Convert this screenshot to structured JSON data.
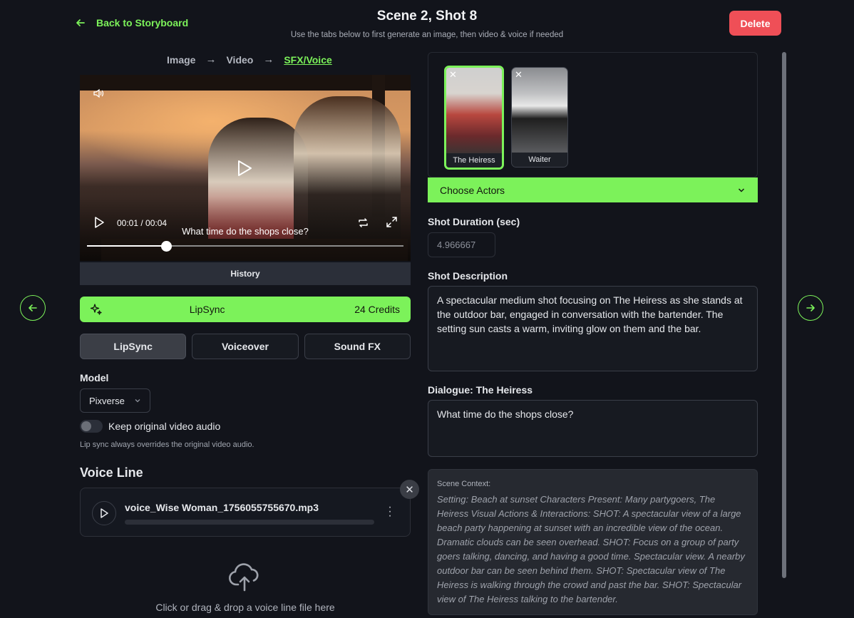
{
  "header": {
    "back_label": "Back to Storyboard",
    "title": "Scene 2, Shot 8",
    "subtitle": "Use the tabs below to first generate an image, then video & voice if needed",
    "delete_label": "Delete"
  },
  "steps": [
    "Image",
    "Video",
    "SFX/Voice"
  ],
  "video": {
    "time": "00:01 / 00:04",
    "caption": "What time do the shops close?",
    "progress_fraction": 0.25
  },
  "history_label": "History",
  "lipsync_bar": {
    "label": "LipSync",
    "credits": "24 Credits"
  },
  "tabs": [
    "LipSync",
    "Voiceover",
    "Sound FX"
  ],
  "model": {
    "label": "Model",
    "value": "Pixverse"
  },
  "toggle": {
    "label": "Keep original video audio",
    "on": false
  },
  "hint": "Lip sync always overrides the original video audio.",
  "voice": {
    "title": "Voice Line",
    "file": "voice_Wise Woman_1756055755670.mp3"
  },
  "upload_text": "Click or drag & drop a voice line file here",
  "actors": [
    {
      "name": "The Heiress",
      "selected": true
    },
    {
      "name": "Waiter",
      "selected": false
    }
  ],
  "choose_actors_label": "Choose Actors",
  "duration": {
    "label": "Shot Duration (sec)",
    "value": "4.966667"
  },
  "description": {
    "label": "Shot Description",
    "value": "A spectacular medium shot focusing on The Heiress as she stands at the outdoor bar, engaged in conversation with the bartender. The setting sun casts a warm, inviting glow on them and the bar."
  },
  "dialogue": {
    "label": "Dialogue: The Heiress",
    "value": "What time do the shops close?"
  },
  "context": {
    "title": "Scene Context:",
    "body": "Setting: Beach at sunset Characters Present: Many partygoers, The Heiress Visual Actions & Interactions: SHOT: A spectacular view of a large beach party happening at sunset with an incredible view of the ocean. Dramatic clouds can be seen overhead. SHOT: Focus on a group of party goers talking, dancing, and having a good time. Spectacular view. A nearby outdoor bar can be seen behind them. SHOT: Spectacular view of The Heiress is walking through the crowd and past the bar. SHOT: Spectacular view of The Heiress talking to the bartender."
  },
  "colors": {
    "accent": "#7cf25a",
    "danger": "#ef4f57",
    "background": "#12141b"
  }
}
